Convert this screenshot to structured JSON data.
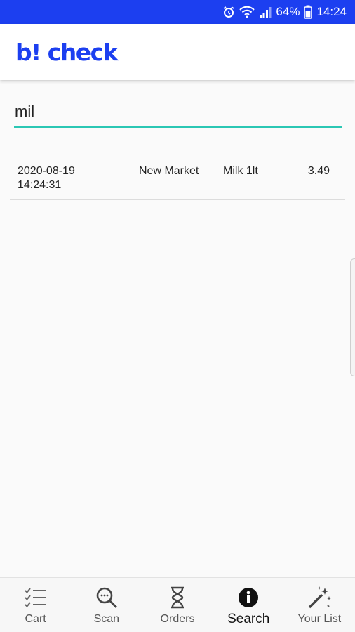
{
  "status_bar": {
    "battery": "64%",
    "time": "14:24",
    "icons": [
      "alarm-icon",
      "wifi-icon",
      "signal-icon",
      "battery-icon"
    ]
  },
  "app_bar": {
    "logo": "b! check"
  },
  "search": {
    "value": "mil",
    "placeholder": ""
  },
  "results": [
    {
      "date": "2020-08-19",
      "time": "14:24:31",
      "store": "New Market",
      "product": "Milk 1lt",
      "price": "3.49"
    }
  ],
  "bottom_nav": {
    "items": [
      {
        "label": "Cart",
        "icon": "checklist-icon"
      },
      {
        "label": "Scan",
        "icon": "search-icon"
      },
      {
        "label": "Orders",
        "icon": "hourglass-icon"
      },
      {
        "label": "Search",
        "icon": "info-icon"
      },
      {
        "label": "Your List",
        "icon": "magic-wand-icon"
      }
    ],
    "active": "Search"
  },
  "colors": {
    "primary": "#1c3ff0",
    "accent": "#2bc7b4",
    "background": "#fafafa"
  }
}
